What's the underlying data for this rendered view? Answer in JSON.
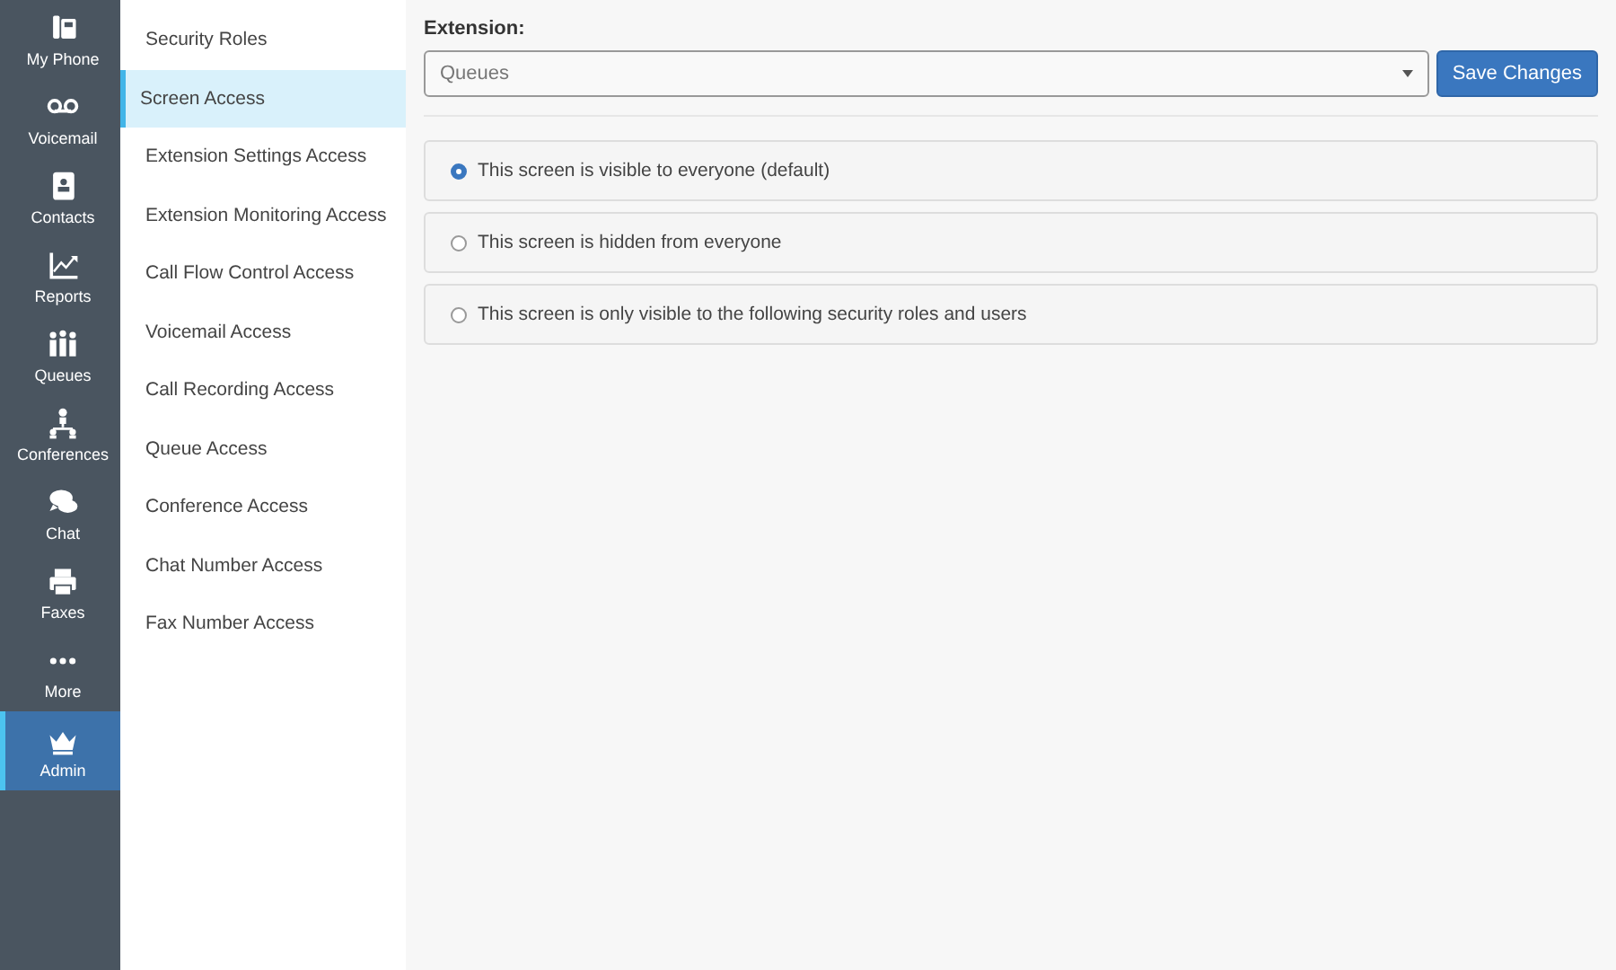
{
  "nav": [
    {
      "label": "My Phone",
      "selected": false
    },
    {
      "label": "Voicemail",
      "selected": false
    },
    {
      "label": "Contacts",
      "selected": false
    },
    {
      "label": "Reports",
      "selected": false
    },
    {
      "label": "Queues",
      "selected": false
    },
    {
      "label": "Conferences",
      "selected": false
    },
    {
      "label": "Chat",
      "selected": false
    },
    {
      "label": "Faxes",
      "selected": false
    },
    {
      "label": "More",
      "selected": false
    },
    {
      "label": "Admin",
      "selected": true
    }
  ],
  "submenu": [
    {
      "label": "Security Roles",
      "selected": false
    },
    {
      "label": "Screen Access",
      "selected": true
    },
    {
      "label": "Extension Settings Access",
      "selected": false
    },
    {
      "label": "Extension Monitoring Access",
      "selected": false
    },
    {
      "label": "Call Flow Control Access",
      "selected": false
    },
    {
      "label": "Voicemail Access",
      "selected": false
    },
    {
      "label": "Call Recording Access",
      "selected": false
    },
    {
      "label": "Queue Access",
      "selected": false
    },
    {
      "label": "Conference Access",
      "selected": false
    },
    {
      "label": "Chat Number Access",
      "selected": false
    },
    {
      "label": "Fax Number Access",
      "selected": false
    }
  ],
  "extension": {
    "label": "Extension:",
    "value": "Queues"
  },
  "save_button": "Save Changes",
  "options": [
    {
      "label": "This screen is visible to everyone (default)",
      "selected": true
    },
    {
      "label": "This screen is hidden from everyone",
      "selected": false
    },
    {
      "label": "This screen is only visible to the following security roles and users",
      "selected": false
    }
  ]
}
